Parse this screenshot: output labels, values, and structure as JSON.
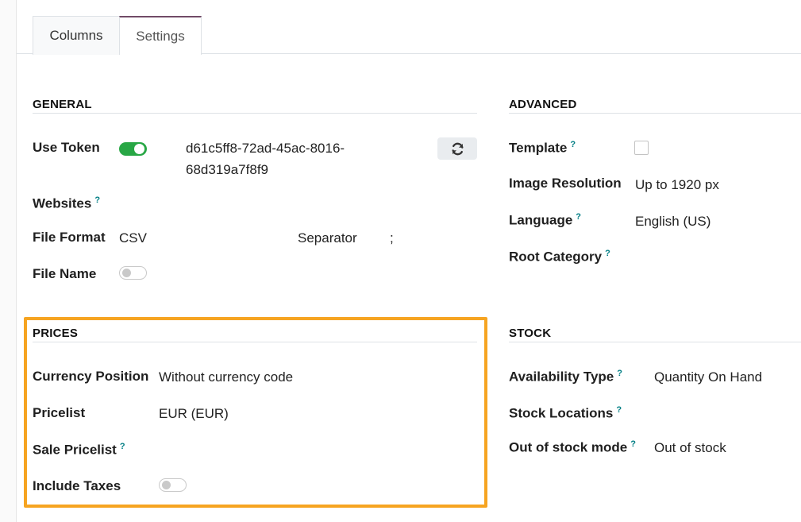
{
  "tabs": {
    "columns": "Columns",
    "settings": "Settings"
  },
  "general": {
    "title": "GENERAL",
    "use_token_label": "Use Token",
    "token_line1": "d61c5ff8-72ad-45ac-8016-",
    "token_line2": "68d319a7f8f9",
    "websites_label": "Websites",
    "file_format_label": "File Format",
    "file_format_value": "CSV",
    "separator_label": "Separator",
    "separator_value": ";",
    "file_name_label": "File Name"
  },
  "advanced": {
    "title": "ADVANCED",
    "template_label": "Template",
    "image_resolution_label": "Image Resolution",
    "image_resolution_value": "Up to 1920 px",
    "language_label": "Language",
    "language_value": "English (US)",
    "root_category_label": "Root Category"
  },
  "prices": {
    "title": "PRICES",
    "currency_position_label": "Currency Position",
    "currency_position_value": "Without currency code",
    "pricelist_label": "Pricelist",
    "pricelist_value": "EUR (EUR)",
    "sale_pricelist_label": "Sale Pricelist",
    "include_taxes_label": "Include Taxes"
  },
  "stock": {
    "title": "STOCK",
    "availability_type_label": "Availability Type",
    "availability_type_value": "Quantity On Hand",
    "stock_locations_label": "Stock Locations",
    "out_of_stock_mode_label": "Out of stock mode",
    "out_of_stock_mode_value": "Out of stock"
  },
  "help_mark": "?",
  "colors": {
    "accent": "#714b67",
    "toggle_on": "#28a745",
    "help": "#017e84",
    "highlight": "#f6a421"
  },
  "icons": {
    "refresh": "refresh-icon"
  }
}
